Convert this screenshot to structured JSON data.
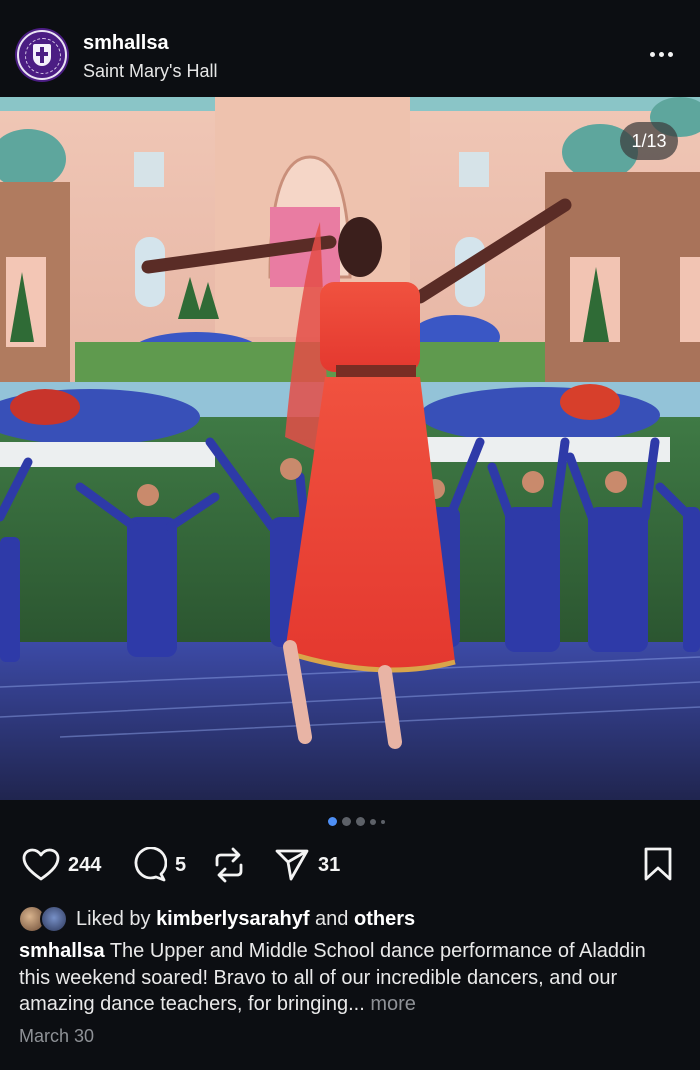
{
  "post": {
    "username": "smhallsa",
    "account_name": "Saint Mary's Hall",
    "avatar_icon": "school-crest-icon",
    "menu_icon": "more-horizontal-icon"
  },
  "media": {
    "counter": "1/13",
    "current_index": 1,
    "total": 13,
    "description_icon": "dance-performance-photo"
  },
  "actions": {
    "likes_count": "244",
    "comments_count": "5",
    "shares_count": "31",
    "icons": [
      "heart-icon",
      "comment-icon",
      "repost-icon",
      "send-icon",
      "bookmark-icon"
    ]
  },
  "liked_by": {
    "prefix": "Liked by",
    "user": "kimberlysarahyf",
    "connector": "and",
    "others": "others"
  },
  "caption": {
    "username": "smhallsa",
    "text": "The Upper and Middle School dance performance of Aladdin this weekend soared! Bravo to all of our incredible dancers, and our amazing dance teachers, for bringing...",
    "more": "more"
  },
  "date": "March 30",
  "colors": {
    "background": "#0c0e12",
    "accent_dot": "#4e8ff5",
    "crest_purple": "#4b1d83"
  }
}
